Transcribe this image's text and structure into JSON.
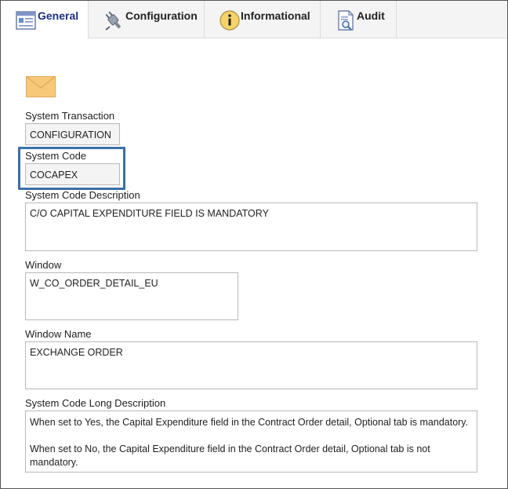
{
  "tabs": [
    {
      "label": "General",
      "icon": "general-form-icon",
      "active": true
    },
    {
      "label": "Configuration",
      "icon": "plug-icon",
      "active": false
    },
    {
      "label": "Informational",
      "icon": "info-icon",
      "active": false
    },
    {
      "label": "Audit",
      "icon": "audit-document-icon",
      "active": false
    }
  ],
  "form": {
    "icon": "envelope-icon",
    "system_transaction": {
      "label": "System Transaction",
      "value": "CONFIGURATION"
    },
    "system_code": {
      "label": "System Code",
      "value": "COCAPEX"
    },
    "system_code_description": {
      "label": "System Code Description",
      "value": "C/O CAPITAL EXPENDITURE FIELD IS MANDATORY"
    },
    "window": {
      "label": "Window",
      "value": "W_CO_ORDER_DETAIL_EU"
    },
    "window_name": {
      "label": "Window Name",
      "value": "EXCHANGE ORDER"
    },
    "long_description": {
      "label": "System Code Long Description",
      "line1": "When set to Yes, the Capital Expenditure field in the Contract Order detail, Optional tab is mandatory.",
      "line2": "When set to No, the Capital Expenditure field in the Contract Order detail, Optional tab is not mandatory."
    }
  },
  "colors": {
    "highlight": "#3a70a8",
    "active_tab_text": "#1a2f80",
    "envelope": "#f7c878"
  }
}
